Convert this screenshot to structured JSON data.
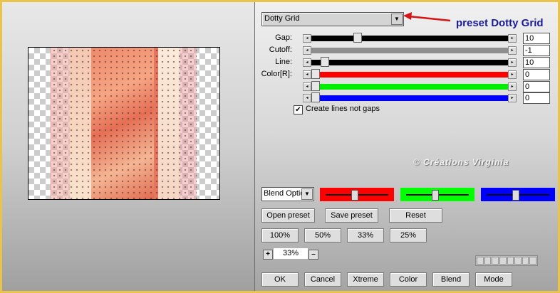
{
  "preset": {
    "selected": "Dotty Grid",
    "annotation": "preset Dotty Grid"
  },
  "params": [
    {
      "label": "Gap:",
      "value": "10",
      "level": 0.22
    },
    {
      "label": "Cutoff:",
      "value": "-1",
      "level": null
    },
    {
      "label": "Line:",
      "value": "10",
      "level": 0.05
    },
    {
      "label": "Color[R]:",
      "value": "0",
      "level": 0,
      "color": "#ff0000"
    },
    {
      "label": "",
      "value": "0",
      "level": 0,
      "color": "#00ee00"
    },
    {
      "label": "",
      "value": "0",
      "level": 0,
      "color": "#0000ff"
    }
  ],
  "checkbox": {
    "label": "Create lines not gaps",
    "checked": true
  },
  "watermark": "© Créations Virginia",
  "blend": {
    "selected": "Blend Optio"
  },
  "color_boxes": [
    "#ff0000",
    "#00ff00",
    "#0000ff"
  ],
  "preset_buttons": {
    "open": "Open preset",
    "save": "Save preset",
    "reset": "Reset"
  },
  "zoom_buttons": [
    "100%",
    "50%",
    "33%",
    "25%"
  ],
  "zoom": {
    "plus": "+",
    "value": "33%",
    "minus": "–"
  },
  "bottom_buttons": [
    "OK",
    "Cancel",
    "Xtreme",
    "Color",
    "Blend",
    "Mode"
  ],
  "progress_segments": 8
}
